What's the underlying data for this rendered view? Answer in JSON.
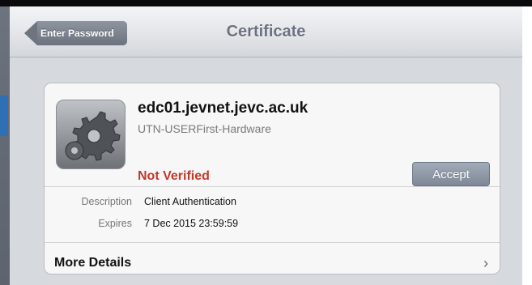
{
  "navbar": {
    "back_label": "Enter Password",
    "title": "Certificate"
  },
  "certificate": {
    "name": "edc01.jevnet.jevc.ac.uk",
    "issuer": "UTN-USERFirst-Hardware",
    "status": "Not Verified",
    "accept_label": "Accept",
    "description_label": "Description",
    "description_value": "Client Authentication",
    "expires_label": "Expires",
    "expires_value": "7 Dec 2015 23:59:59",
    "more_details_label": "More Details"
  },
  "colors": {
    "status_red": "#c0392b",
    "nav_button": "#7a828d",
    "sheet_bg": "#d6d9de"
  },
  "icons": [
    "gear-icon",
    "chevron-right-icon",
    "back-arrow-icon"
  ]
}
